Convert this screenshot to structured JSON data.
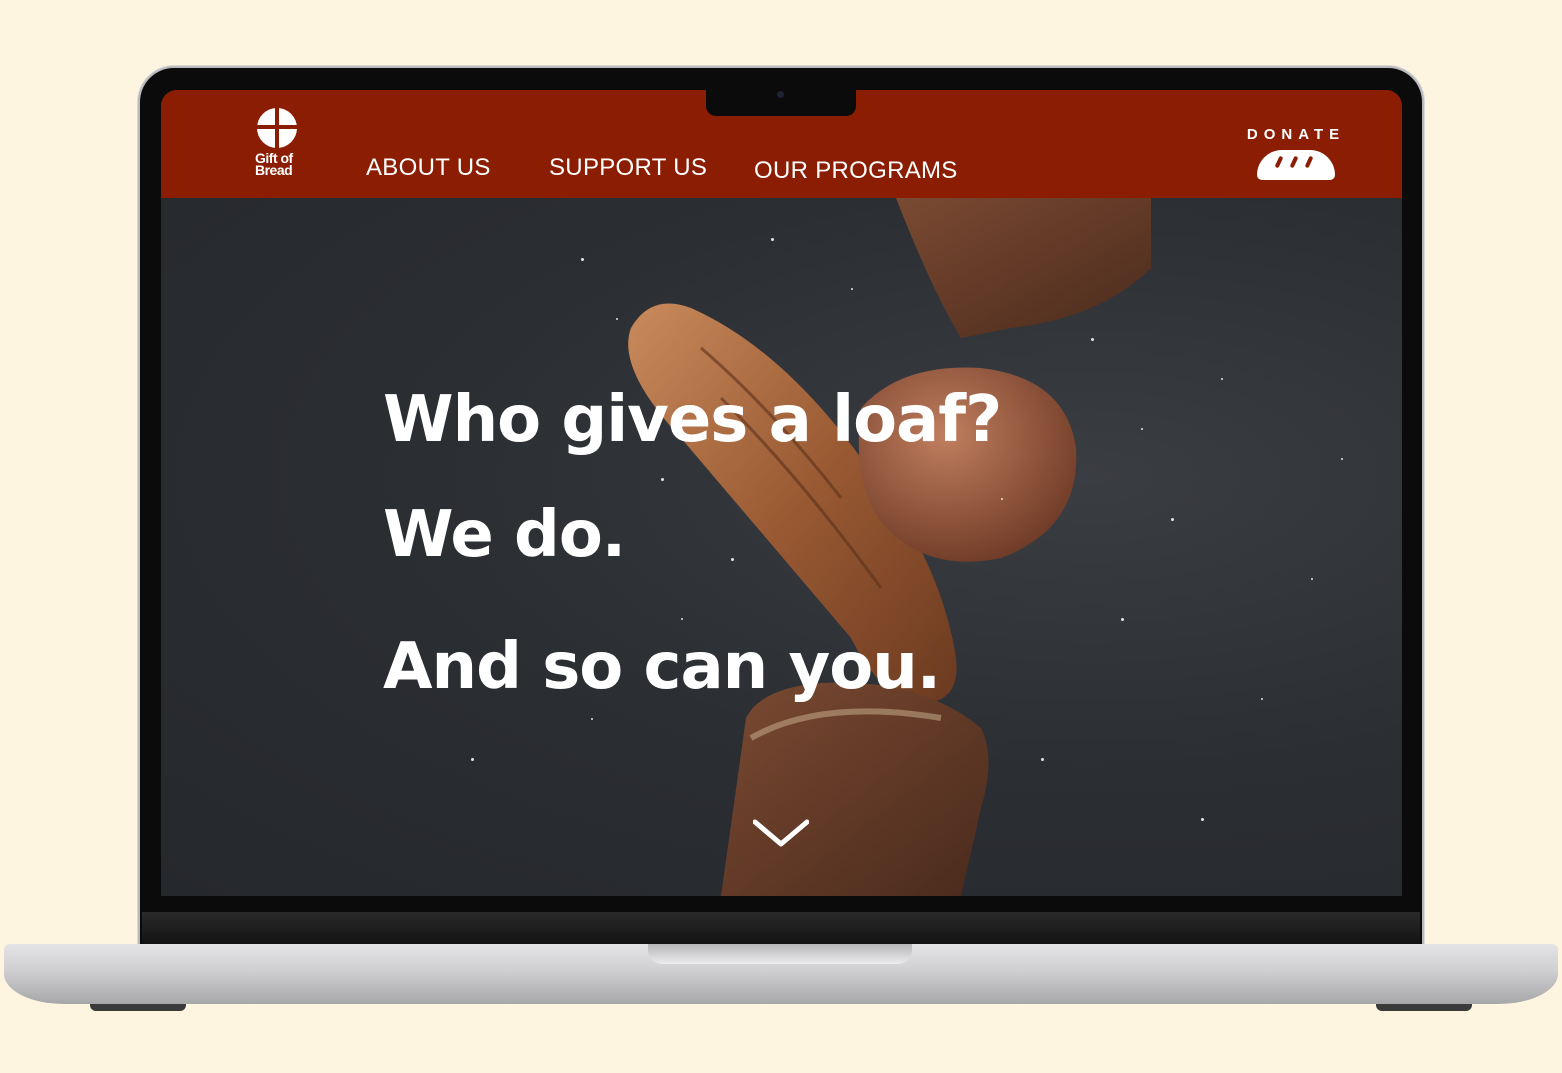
{
  "brand": {
    "name_line1": "Gift of",
    "name_line2": "Bread"
  },
  "nav": {
    "about": "ABOUT US",
    "support": "SUPPORT US",
    "programs": "OUR PROGRAMS",
    "donate": "DONATE"
  },
  "hero": {
    "line1": "Who gives a loaf?",
    "line2": "We do.",
    "line3": "And so can you."
  },
  "colors": {
    "header": "#8b1e02",
    "page_background": "#fdf5df",
    "hero_background": "#2b2e33",
    "text": "#ffffff"
  },
  "icons": [
    "cross-logo-icon",
    "bread-loaf-icon",
    "chevron-down-icon"
  ]
}
